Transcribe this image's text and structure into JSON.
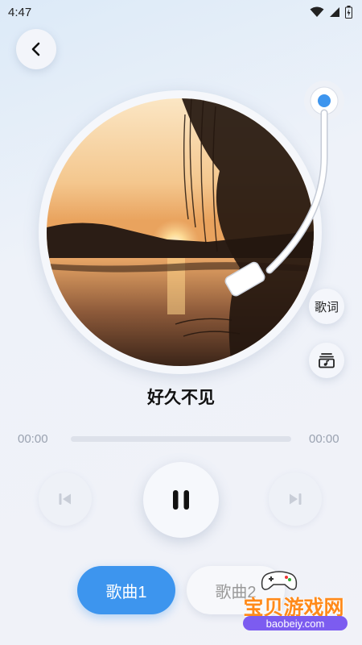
{
  "status_bar": {
    "time": "4:47"
  },
  "player": {
    "song_title": "好久不见",
    "current_time": "00:00",
    "total_time": "00:00",
    "progress": 0,
    "is_playing": true,
    "lyrics_label": "歌词"
  },
  "tabs": [
    {
      "label": "歌曲1",
      "active": true
    },
    {
      "label": "歌曲2",
      "active": false
    }
  ],
  "watermark": {
    "text": "宝贝游戏网",
    "url": "baobeiy.com"
  },
  "colors": {
    "accent": "#3d95ee",
    "progress_track": "#dde1ea",
    "watermark_orange": "#ff8a1a"
  },
  "icons": [
    "back-arrow-icon",
    "wifi-icon",
    "signal-icon",
    "battery-icon",
    "playlist-icon",
    "prev-icon",
    "pause-icon",
    "next-icon"
  ]
}
